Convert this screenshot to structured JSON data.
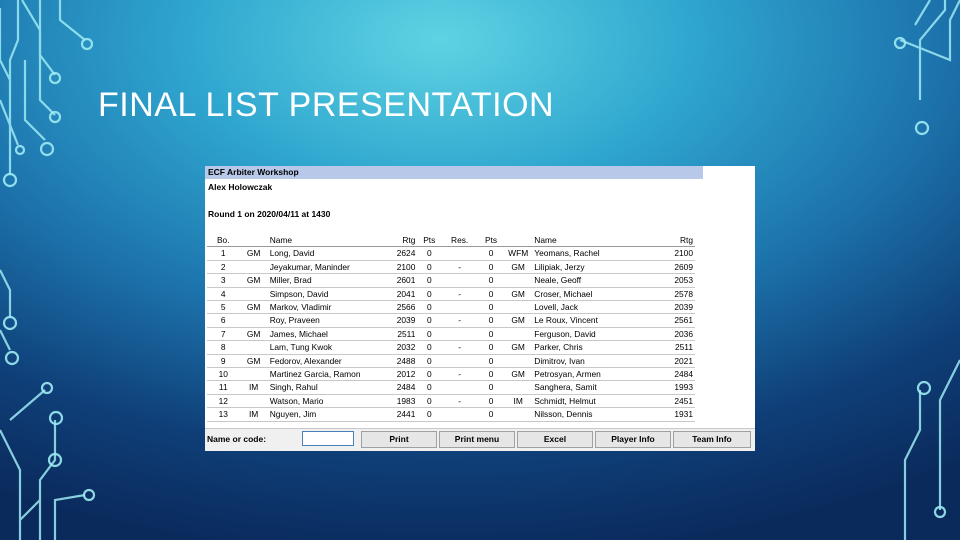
{
  "slide": {
    "title": "FINAL LIST PRESENTATION"
  },
  "app": {
    "window_title": "ECF Arbiter Workshop",
    "author": "Alex Holowczak",
    "round_info": "Round 1 on 2020/04/11 at 1430",
    "columns": [
      "Bo.",
      "",
      "Name",
      "Rtg",
      "Pts",
      "Res.",
      "Pts",
      "",
      "Name",
      "Rtg"
    ],
    "rows": [
      {
        "bo": "1",
        "t1": "GM",
        "n1": "Long, David",
        "r1": "2624",
        "p1": "0",
        "res": "",
        "p2": "0",
        "t2": "WFM",
        "n2": "Yeomans, Rachel",
        "r2": "2100"
      },
      {
        "bo": "2",
        "t1": "",
        "n1": "Jeyakumar, Maninder",
        "r1": "2100",
        "p1": "0",
        "res": "-",
        "p2": "0",
        "t2": "GM",
        "n2": "Lilipiak, Jerzy",
        "r2": "2609"
      },
      {
        "bo": "3",
        "t1": "GM",
        "n1": "Miller, Brad",
        "r1": "2601",
        "p1": "0",
        "res": "",
        "p2": "0",
        "t2": "",
        "n2": "Neale, Geoff",
        "r2": "2053"
      },
      {
        "bo": "4",
        "t1": "",
        "n1": "Simpson, David",
        "r1": "2041",
        "p1": "0",
        "res": "-",
        "p2": "0",
        "t2": "GM",
        "n2": "Croser, Michael",
        "r2": "2578"
      },
      {
        "bo": "5",
        "t1": "GM",
        "n1": "Markov, Vladimir",
        "r1": "2566",
        "p1": "0",
        "res": "",
        "p2": "0",
        "t2": "",
        "n2": "Lovell, Jack",
        "r2": "2039"
      },
      {
        "bo": "6",
        "t1": "",
        "n1": "Roy, Praveen",
        "r1": "2039",
        "p1": "0",
        "res": "-",
        "p2": "0",
        "t2": "GM",
        "n2": "Le Roux, Vincent",
        "r2": "2561"
      },
      {
        "bo": "7",
        "t1": "GM",
        "n1": "James, Michael",
        "r1": "2511",
        "p1": "0",
        "res": "",
        "p2": "0",
        "t2": "",
        "n2": "Ferguson, David",
        "r2": "2036"
      },
      {
        "bo": "8",
        "t1": "",
        "n1": "Lam, Tung Kwok",
        "r1": "2032",
        "p1": "0",
        "res": "-",
        "p2": "0",
        "t2": "GM",
        "n2": "Parker, Chris",
        "r2": "2511"
      },
      {
        "bo": "9",
        "t1": "GM",
        "n1": "Fedorov, Alexander",
        "r1": "2488",
        "p1": "0",
        "res": "",
        "p2": "0",
        "t2": "",
        "n2": "Dimitrov, Ivan",
        "r2": "2021"
      },
      {
        "bo": "10",
        "t1": "",
        "n1": "Martinez Garcia, Ramon",
        "r1": "2012",
        "p1": "0",
        "res": "-",
        "p2": "0",
        "t2": "GM",
        "n2": "Petrosyan, Armen",
        "r2": "2484"
      },
      {
        "bo": "11",
        "t1": "IM",
        "n1": "Singh, Rahul",
        "r1": "2484",
        "p1": "0",
        "res": "",
        "p2": "0",
        "t2": "",
        "n2": "Sanghera, Samit",
        "r2": "1993"
      },
      {
        "bo": "12",
        "t1": "",
        "n1": "Watson, Mario",
        "r1": "1983",
        "p1": "0",
        "res": "-",
        "p2": "0",
        "t2": "IM",
        "n2": "Schmidt, Helmut",
        "r2": "2451"
      },
      {
        "bo": "13",
        "t1": "IM",
        "n1": "Nguyen, Jim",
        "r1": "2441",
        "p1": "0",
        "res": "",
        "p2": "0",
        "t2": "",
        "n2": "Nilsson, Dennis",
        "r2": "1931"
      }
    ],
    "bottom": {
      "name_label": "Name or code:",
      "name_value": "",
      "buttons": [
        "Print",
        "Print menu",
        "Excel",
        "Player Info",
        "Team Info"
      ]
    }
  },
  "colors": {
    "header_bar": "#b7c8e8",
    "input_border": "#4a7fb5"
  }
}
